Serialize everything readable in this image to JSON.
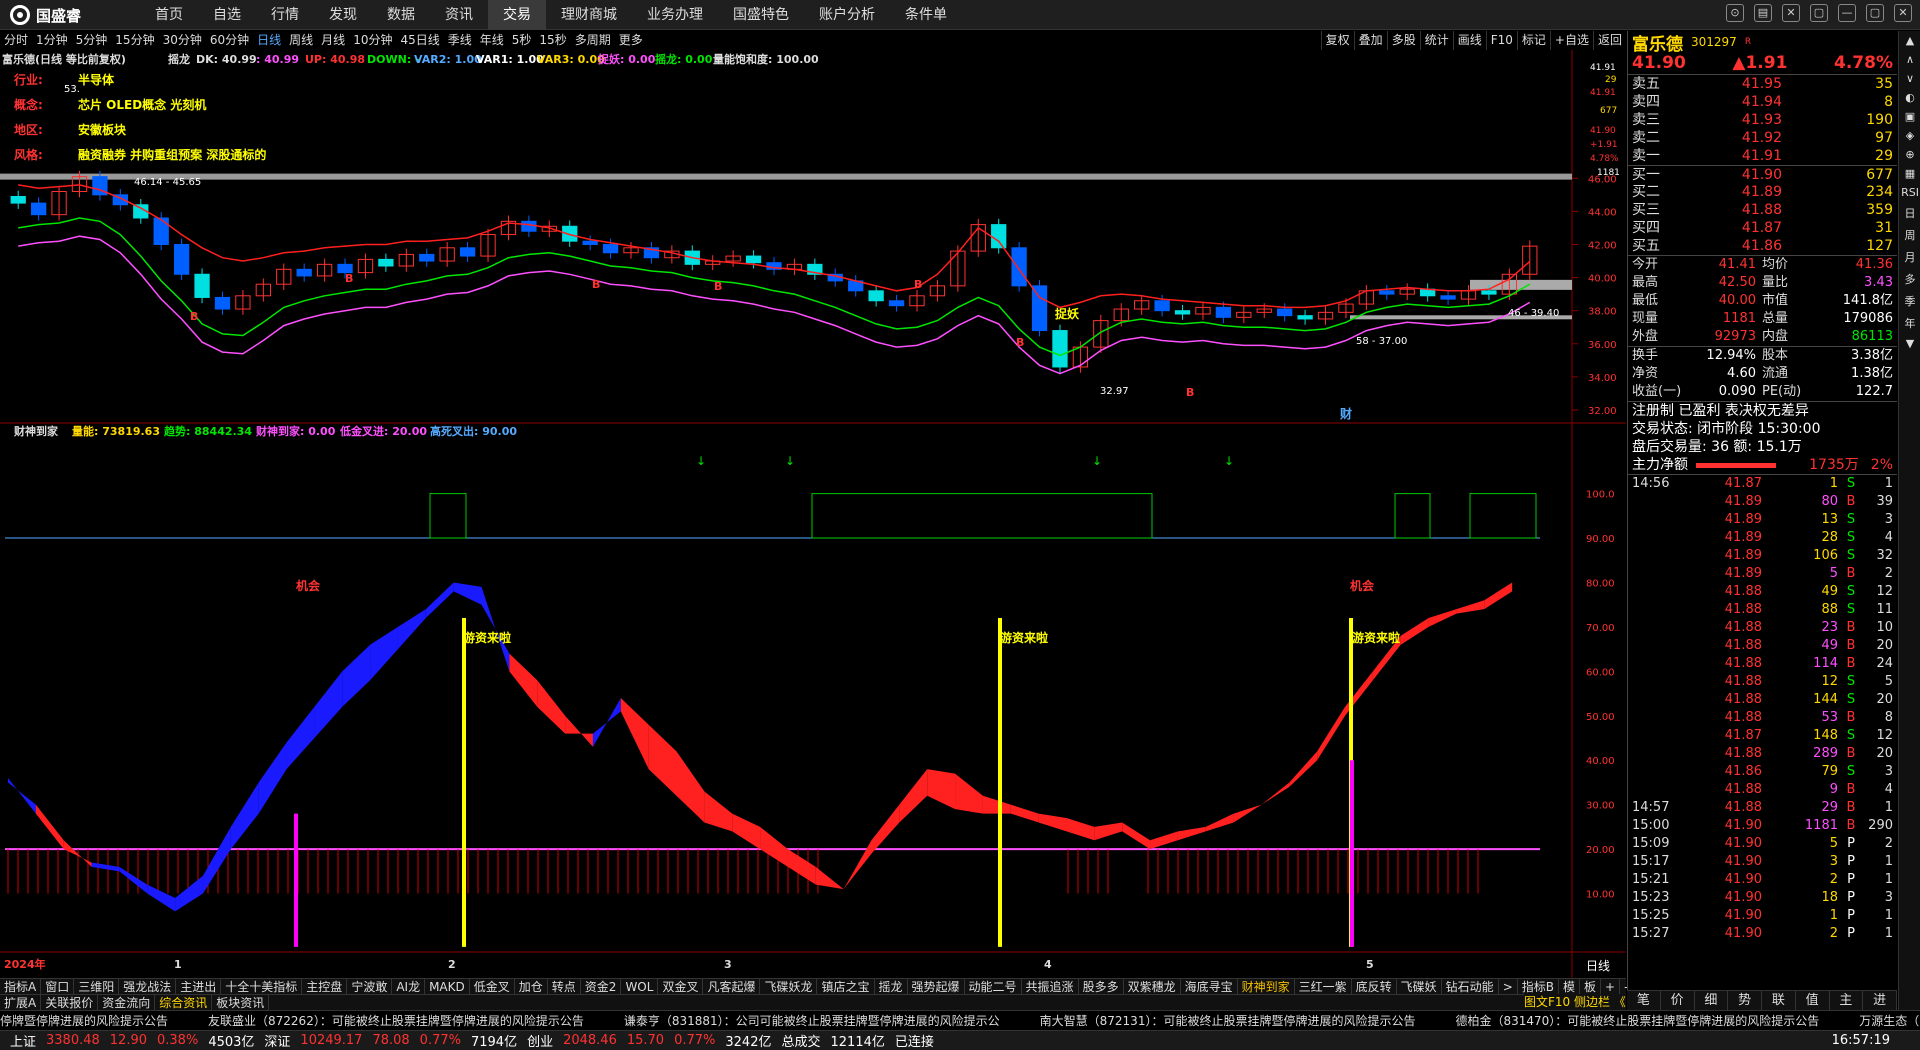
{
  "topbar": {
    "logo_text": "国盛睿",
    "menu": [
      "首页",
      "自选",
      "行情",
      "发现",
      "数据",
      "资讯",
      "交易",
      "理财商城",
      "业务办理",
      "国盛特色",
      "账户分析",
      "条件单"
    ],
    "active": "交易",
    "window_controls": [
      "⊙",
      "▤",
      "✕",
      "▢",
      "—",
      "▢",
      "✕"
    ]
  },
  "periods": {
    "items": [
      "分时",
      "1分钟",
      "5分钟",
      "15分钟",
      "30分钟",
      "60分钟",
      "日线",
      "周线",
      "月线",
      "10分钟",
      "45日线",
      "季线",
      "年线",
      "5秒",
      "15秒",
      "多周期",
      "更多"
    ],
    "active": "日线"
  },
  "right_tools": [
    "复权",
    "叠加",
    "多股",
    "统计",
    "画线",
    "F10",
    "标记",
    "+自选",
    "返回"
  ],
  "chart_header": {
    "title": "富乐德(日线 等比前复权)",
    "indicator": "摇龙",
    "dk_label": "DK: 40.99",
    "line2_label": ": 40.99",
    "up_label": "UP: 40.98",
    "down_label": "DOWN: -",
    "var2_label": "VAR2: 1.00",
    "var1_label": "VAR1: 1.00",
    "var3_label": "VAR3: 0.00",
    "zhuoyao_label": "捉妖: 0.00",
    "yaolong_label": "摇龙: 0.00",
    "baohe_label": "量能饱和度: 100.00"
  },
  "info_overlay": {
    "industry_label": "行业:",
    "industry": "半导体",
    "concept_label": "概念:",
    "concept": "芯片 OLED概念 光刻机",
    "region_label": "地区:",
    "region": "安徽板块",
    "style_label": "风格:",
    "style": "融资融券 并购重组预案 深股通标的"
  },
  "price_annotations": {
    "high_label": "53.",
    "zone1": "46.14 - 45.65",
    "zone2": "46 - 39.40",
    "zone3": "58 - 37.00",
    "low_label": "32.97",
    "zhuoyao_text": "捉妖",
    "cai_text": "财",
    "b_markers": [
      "B",
      "B",
      "B",
      "B",
      "B",
      "B",
      "B"
    ]
  },
  "price_axis": [
    "46.00",
    "44.00",
    "42.00",
    "40.00",
    "38.00",
    "36.00",
    "34.00",
    "32.00"
  ],
  "mini_axis": {
    "top": "41.91",
    "v29": "29",
    "v41": "41.91",
    "v677": "677",
    "vprice": "41.90",
    "vchg": "+1.91",
    "vpct": "4.78%",
    "v1181": "1181"
  },
  "lower_header": {
    "title": "财神到家",
    "liangneng": "量能: 73819.63",
    "qushi": "趋势: 88442.34",
    "caishen": "财神到家: 0.00",
    "dijin": "低金叉进: 20.00",
    "gaosi": "高死叉出: 90.00"
  },
  "lower_axis": [
    "100.0",
    "90.00",
    "80.00",
    "70.00",
    "60.00",
    "50.00",
    "40.00",
    "30.00",
    "20.00",
    "10.00"
  ],
  "lower_annotations": {
    "jihui1": "机会",
    "jihui2": "机会",
    "youzi1": "游资来啦",
    "youzi2": "游资来啦",
    "youzi3": "游资来啦"
  },
  "x_axis": {
    "year": "2024年",
    "months": [
      "1",
      "2",
      "3",
      "4",
      "5"
    ],
    "period_btn": "日线"
  },
  "chart_data": {
    "type": "candlestick",
    "xlabel": "",
    "ylabel": "",
    "ylim": [
      32,
      46.5
    ],
    "series": [
      {
        "name": "K线",
        "ohlc_note": "daily candles Jan–May 2024",
        "closes": [
          44.5,
          43.8,
          45.2,
          46.1,
          45.0,
          44.4,
          43.6,
          42.0,
          40.2,
          38.8,
          38.1,
          38.9,
          39.6,
          40.5,
          40.1,
          40.8,
          40.3,
          41.1,
          40.7,
          41.4,
          41.0,
          41.8,
          41.3,
          42.6,
          43.4,
          42.8,
          43.1,
          42.2,
          42.0,
          41.5,
          41.8,
          41.2,
          41.6,
          40.8,
          41.0,
          41.3,
          40.9,
          40.5,
          40.8,
          40.2,
          39.8,
          39.2,
          38.6,
          38.3,
          38.9,
          39.5,
          41.6,
          43.2,
          41.8,
          39.5,
          36.8,
          34.6,
          35.8,
          37.4,
          38.1,
          38.6,
          38.0,
          37.8,
          38.2,
          37.6,
          37.9,
          38.1,
          37.7,
          37.5,
          37.9,
          38.4,
          39.2,
          39.0,
          39.3,
          38.9,
          38.7,
          39.2,
          39.0,
          40.2,
          41.9
        ]
      },
      {
        "name": "UP",
        "values": [
          45.6,
          45.4,
          45.5,
          45.6,
          45.3,
          44.8,
          44.2,
          43.5,
          42.6,
          41.8,
          41.2,
          41.0,
          41.2,
          41.5,
          41.6,
          41.8,
          41.9,
          42.0,
          42.0,
          42.2,
          42.2,
          42.3,
          42.4,
          42.8,
          43.3,
          43.2,
          43.0,
          42.6,
          42.3,
          42.1,
          41.9,
          41.7,
          41.5,
          41.2,
          41.0,
          40.9,
          40.8,
          40.6,
          40.5,
          40.3,
          40.1,
          39.8,
          39.5,
          39.2,
          39.4,
          40.2,
          41.5,
          43.0,
          42.2,
          40.5,
          38.8,
          38.2,
          38.5,
          38.9,
          39.0,
          38.9,
          38.7,
          38.6,
          38.5,
          38.4,
          38.3,
          38.3,
          38.2,
          38.2,
          38.3,
          38.6,
          39.2,
          39.3,
          39.4,
          39.3,
          39.2,
          39.2,
          39.3,
          39.9,
          40.98
        ]
      },
      {
        "name": "DOWN",
        "values": [
          43.0,
          43.2,
          43.3,
          43.6,
          43.4,
          42.6,
          41.3,
          39.8,
          38.6,
          37.2,
          36.6,
          36.5,
          37.3,
          38.2,
          38.6,
          38.9,
          39.1,
          39.3,
          39.3,
          39.6,
          39.8,
          40.1,
          40.2,
          40.6,
          41.2,
          41.4,
          41.5,
          41.3,
          41.0,
          40.7,
          40.6,
          40.4,
          40.3,
          40.0,
          39.8,
          39.7,
          39.5,
          39.2,
          39.0,
          38.6,
          38.2,
          37.7,
          37.2,
          36.9,
          37.0,
          37.4,
          38.2,
          38.8,
          38.3,
          36.9,
          35.8,
          35.3,
          35.8,
          36.7,
          37.3,
          37.5,
          37.3,
          37.2,
          37.3,
          37.1,
          37.0,
          37.0,
          36.9,
          36.8,
          36.9,
          37.3,
          37.9,
          38.2,
          38.4,
          38.3,
          38.2,
          38.3,
          38.4,
          38.9,
          39.6
        ]
      },
      {
        "name": "量能",
        "values": [
          35,
          30,
          22,
          16,
          15,
          10,
          6,
          10,
          20,
          28,
          38,
          45,
          52,
          58,
          65,
          72,
          78,
          75,
          64,
          58,
          50,
          43,
          54,
          48,
          42,
          33,
          28,
          25,
          20,
          16,
          11,
          22,
          30,
          38,
          37,
          32,
          30,
          28,
          27,
          25,
          26,
          22,
          24,
          25,
          28,
          30,
          35,
          42,
          52,
          60,
          68,
          72,
          74,
          76,
          80
        ]
      },
      {
        "name": "趋势",
        "values": [
          36,
          28,
          20,
          17,
          16,
          12,
          9,
          14,
          25,
          35,
          44,
          52,
          60,
          66,
          70,
          74,
          80,
          79,
          60,
          52,
          46,
          46,
          51,
          38,
          32,
          26,
          24,
          20,
          16,
          12,
          11,
          19,
          26,
          32,
          29,
          28,
          28,
          26,
          24,
          22,
          24,
          20,
          22,
          24,
          26,
          30,
          34,
          40,
          50,
          58,
          66,
          70,
          73,
          74,
          78
        ]
      }
    ]
  },
  "bottom_tabs": [
    "指标A",
    "窗口",
    "三维阳",
    "强龙战法",
    "主进出",
    "十全十美指标",
    "主控盘",
    "宁波敢",
    "AI龙",
    "MAKD",
    "低金叉",
    "加仓",
    "转点",
    "资金2",
    "WOL",
    "双金叉",
    "凡客起爆",
    "飞碟妖龙",
    "镇店之宝",
    "摇龙",
    "强势起爆",
    "动能二号",
    "共振追涨",
    "股多多",
    "双紫穗龙",
    "海底寻宝",
    "财神到家",
    "三红一紫",
    "底反转",
    "飞碟妖",
    "钻石动能",
    ">",
    "指标B",
    "模",
    "板",
    "+",
    "-"
  ],
  "bottom_tabs_active": "财神到家",
  "tabs2": [
    "扩展A",
    "关联报价",
    "资金流向",
    "综合资讯",
    "板块资讯"
  ],
  "tabs2_active": "综合资讯",
  "news": [
    "停牌暨停牌进展的风险提示公告",
    "友联盛业（872262）：可能被终止股票挂牌暨停牌进展的风险提示公告",
    "谦泰亨（831881）：公司可能被终止股票挂牌暨停牌进展的风险提示公",
    "南大智慧（872131）：可能被终止股票挂牌暨停牌进展的风险提示公告",
    "德柏金（831470）：可能被终止股票挂牌暨停牌进展的风险提示公告",
    "万源生态（836"
  ],
  "right_panel_news_tab": "图文F10 侧边栏 《",
  "statusbar": {
    "sh_label": "上证",
    "sh_val": "3380.48",
    "sh_chg": "12.90",
    "sh_pct": "0.38%",
    "sh_amt": "4503亿",
    "sz_label": "深证",
    "sz_val": "10249.17",
    "sz_chg": "78.08",
    "sz_pct": "0.77%",
    "sz_amt": "7194亿",
    "cy_label": "创业",
    "cy_val": "2048.46",
    "cy_chg": "15.70",
    "cy_pct": "0.77%",
    "cy_amt": "3242亿",
    "total_label": "总成交",
    "total_val": "12114亿",
    "conn": "已连接",
    "time": "16:57:19"
  },
  "stock": {
    "name": "富乐德",
    "code": "301297",
    "badge": "R",
    "price": "41.90",
    "change": "▲1.91",
    "pct": "4.78%"
  },
  "orderbook": [
    {
      "label": "卖五",
      "price": "41.95",
      "vol": "35"
    },
    {
      "label": "卖四",
      "price": "41.94",
      "vol": "8"
    },
    {
      "label": "卖三",
      "price": "41.93",
      "vol": "190"
    },
    {
      "label": "卖二",
      "price": "41.92",
      "vol": "97"
    },
    {
      "label": "卖一",
      "price": "41.91",
      "vol": "29"
    },
    {
      "label": "买一",
      "price": "41.90",
      "vol": "677"
    },
    {
      "label": "买二",
      "price": "41.89",
      "vol": "234"
    },
    {
      "label": "买三",
      "price": "41.88",
      "vol": "359"
    },
    {
      "label": "买四",
      "price": "41.87",
      "vol": "31"
    },
    {
      "label": "买五",
      "price": "41.86",
      "vol": "127"
    }
  ],
  "quote": [
    {
      "a": "今开",
      "b": "41.41",
      "c": "均价",
      "d": "41.36",
      "dc": "red"
    },
    {
      "a": "最高",
      "b": "42.50",
      "c": "量比",
      "d": "3.43",
      "dc": "mag"
    },
    {
      "a": "最低",
      "b": "40.00",
      "c": "市值",
      "d": "141.8亿",
      "dc": "wht"
    },
    {
      "a": "现量",
      "b": "1181",
      "c": "总量",
      "d": "179086",
      "dc": "wht"
    },
    {
      "a": "外盘",
      "b": "92973",
      "c": "内盘",
      "d": "86113",
      "dc": "grn"
    }
  ],
  "quote2": [
    {
      "a": "换手",
      "b": "12.94%",
      "c": "股本",
      "d": "3.38亿"
    },
    {
      "a": "净资",
      "b": "4.60",
      "c": "流通",
      "d": "1.38亿"
    },
    {
      "a": "收益(一)",
      "b": "0.090",
      "c": "PE(动)",
      "d": "122.7"
    }
  ],
  "extra_lines": {
    "reg": "注册制 已盈利 表决权无差异",
    "state": "交易状态: 闭市阶段 15:30:00",
    "after": "盘后交易量: 36 额: 15.1万",
    "main_label": "主力净额",
    "main_val": "1735万",
    "main_pct": "2%"
  },
  "ticks": [
    {
      "t": "14:56",
      "p": "41.87",
      "v": "1",
      "f": "S",
      "n": "1"
    },
    {
      "t": "",
      "p": "41.89",
      "v": "80",
      "f": "B",
      "n": "39"
    },
    {
      "t": "",
      "p": "41.89",
      "v": "13",
      "f": "S",
      "n": "3"
    },
    {
      "t": "",
      "p": "41.89",
      "v": "28",
      "f": "S",
      "n": "4"
    },
    {
      "t": "",
      "p": "41.89",
      "v": "106",
      "f": "S",
      "n": "32"
    },
    {
      "t": "",
      "p": "41.89",
      "v": "5",
      "f": "B",
      "n": "2"
    },
    {
      "t": "",
      "p": "41.88",
      "v": "49",
      "f": "S",
      "n": "12"
    },
    {
      "t": "",
      "p": "41.88",
      "v": "88",
      "f": "S",
      "n": "11"
    },
    {
      "t": "",
      "p": "41.88",
      "v": "23",
      "f": "B",
      "n": "10"
    },
    {
      "t": "",
      "p": "41.88",
      "v": "49",
      "f": "B",
      "n": "20"
    },
    {
      "t": "",
      "p": "41.88",
      "v": "114",
      "f": "B",
      "n": "24"
    },
    {
      "t": "",
      "p": "41.88",
      "v": "12",
      "f": "S",
      "n": "5"
    },
    {
      "t": "",
      "p": "41.88",
      "v": "144",
      "f": "S",
      "n": "20"
    },
    {
      "t": "",
      "p": "41.88",
      "v": "53",
      "f": "B",
      "n": "8"
    },
    {
      "t": "",
      "p": "41.87",
      "v": "148",
      "f": "S",
      "n": "12"
    },
    {
      "t": "",
      "p": "41.88",
      "v": "289",
      "f": "B",
      "n": "20"
    },
    {
      "t": "",
      "p": "41.86",
      "v": "79",
      "f": "S",
      "n": "3"
    },
    {
      "t": "",
      "p": "41.88",
      "v": "9",
      "f": "B",
      "n": "4"
    },
    {
      "t": "14:57",
      "p": "41.88",
      "v": "29",
      "f": "B",
      "n": "1"
    },
    {
      "t": "15:00",
      "p": "41.90",
      "v": "1181",
      "f": "B",
      "n": "290"
    },
    {
      "t": "15:09",
      "p": "41.90",
      "v": "5",
      "f": "P",
      "n": "2"
    },
    {
      "t": "15:17",
      "p": "41.90",
      "v": "3",
      "f": "P",
      "n": "1"
    },
    {
      "t": "15:21",
      "p": "41.90",
      "v": "2",
      "f": "P",
      "n": "1"
    },
    {
      "t": "15:23",
      "p": "41.90",
      "v": "18",
      "f": "P",
      "n": "3"
    },
    {
      "t": "15:25",
      "p": "41.90",
      "v": "1",
      "f": "P",
      "n": "1"
    },
    {
      "t": "15:27",
      "p": "41.90",
      "v": "2",
      "f": "P",
      "n": "1"
    }
  ],
  "rtabs": [
    "笔",
    "价",
    "细",
    "势",
    "联",
    "值",
    "主",
    "进"
  ],
  "sidebar": [
    "▲",
    "∧",
    "∨",
    "◐",
    "▣",
    "◈",
    "⊕",
    "▦",
    "RSI",
    "日",
    "周",
    "月",
    "多",
    "季",
    "年",
    "▼"
  ]
}
